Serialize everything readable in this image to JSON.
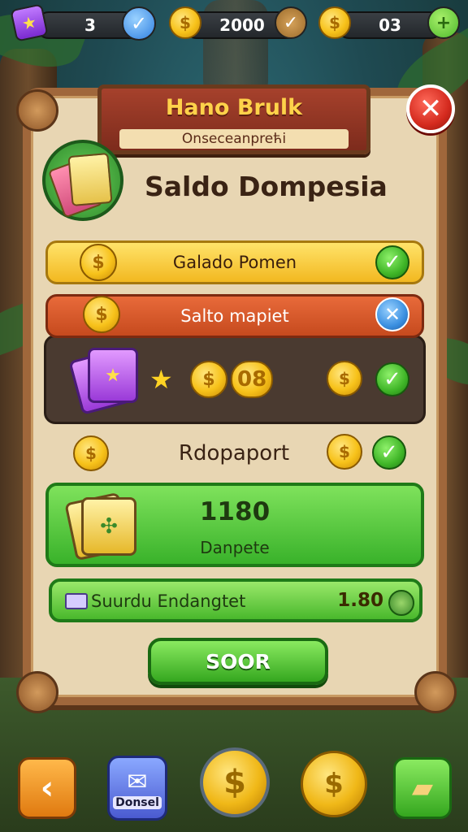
{
  "hud": {
    "gems": "3",
    "coins": "2000",
    "extra": "03"
  },
  "popup": {
    "title": "Hano Brulk",
    "subtitle": "Onsecеanpreћi",
    "header": "Saldo Dompesia"
  },
  "rows": {
    "yellow_label": "Galado Pomen",
    "orange_label": "Salto mapiet",
    "reward_value": "08"
  },
  "section": {
    "label": "Rdopaport",
    "amount": "1180",
    "amount_sub": "Danpete",
    "bar_label": "Suurdu Endangtet",
    "bar_value": "1.80"
  },
  "save_label": "SOOR",
  "bottom": {
    "mail_label": "Donsel"
  },
  "colors": {
    "panel": "#e8d6b3",
    "frame": "#a0673b",
    "green": "#39b22a",
    "banner": "#a6412c"
  }
}
